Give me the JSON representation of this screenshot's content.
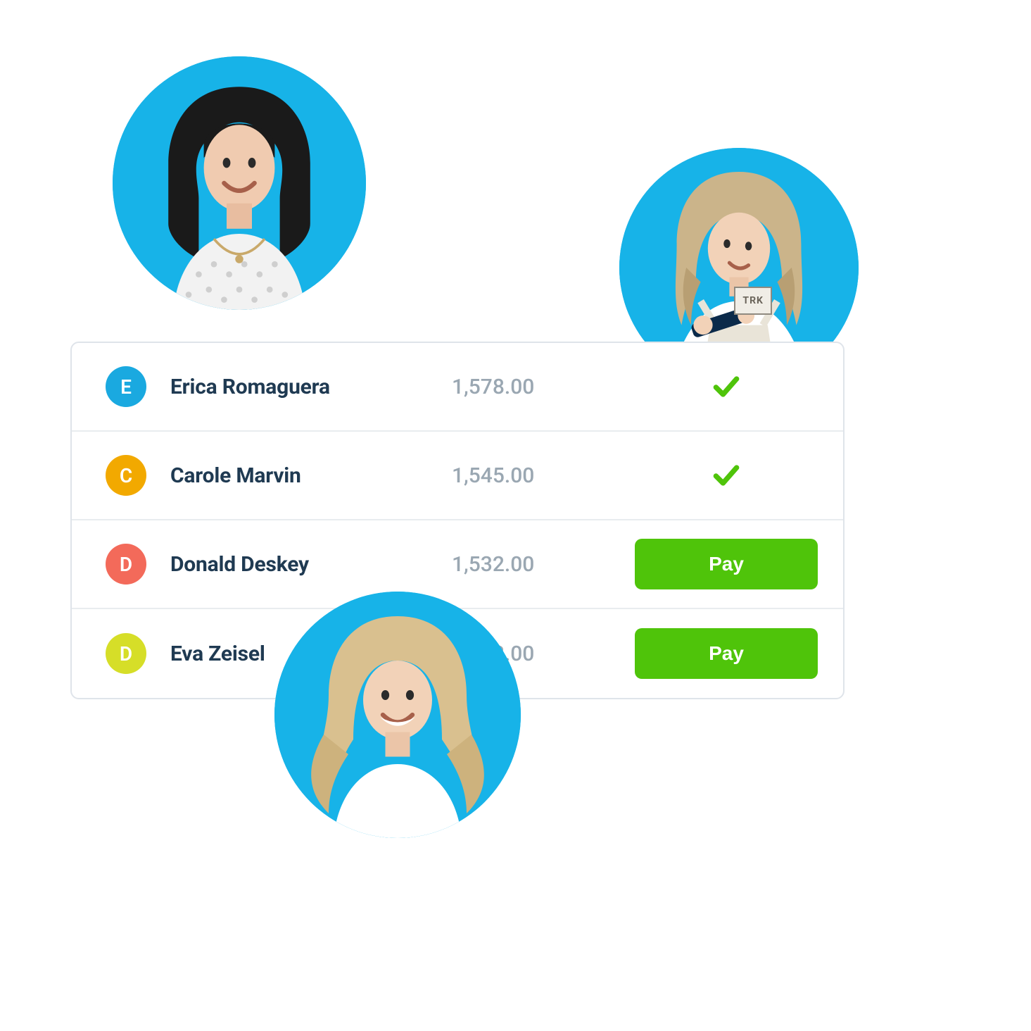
{
  "rows": [
    {
      "initial": "E",
      "name": "Erica Romaguera",
      "amount": "1,578.00",
      "status": "paid",
      "avatarColor": "#1aa9e0"
    },
    {
      "initial": "C",
      "name": "Carole Marvin",
      "amount": "1,545.00",
      "status": "paid",
      "avatarColor": "#f2a900"
    },
    {
      "initial": "D",
      "name": "Donald Deskey",
      "amount": "1,532.00",
      "status": "unpaid",
      "avatarColor": "#f36a5a"
    },
    {
      "initial": "D",
      "name": "Eva Zeisel",
      "amount": "1,532.00",
      "status": "unpaid",
      "avatarColor": "#d6de28"
    }
  ],
  "payLabel": "Pay",
  "decor": {
    "apronBadge": "TRK"
  },
  "colors": {
    "statusCheck": "#4fc40a",
    "buttonBg": "#4fc40a",
    "personBg": "#17b3e8",
    "nameText": "#1f3a52",
    "amountText": "#9aa7b2"
  }
}
